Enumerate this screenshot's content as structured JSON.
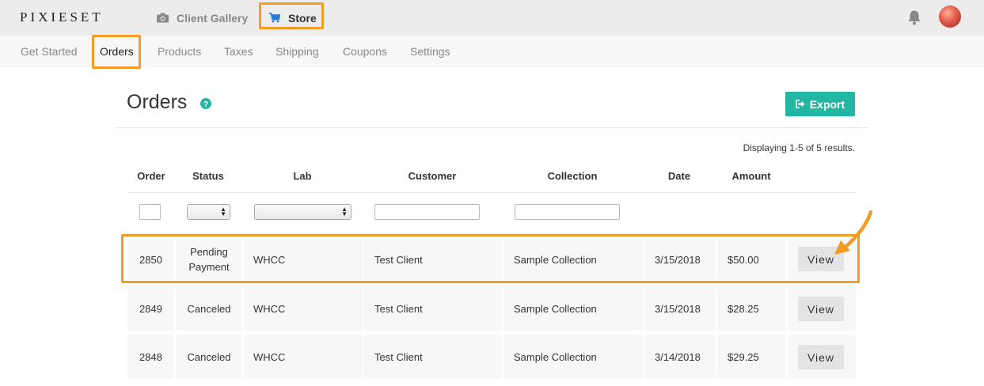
{
  "brand": "PIXIESET",
  "topnav": {
    "gallery_label": "Client Gallery",
    "store_label": "Store"
  },
  "subnav": [
    {
      "label": "Get Started"
    },
    {
      "label": "Orders"
    },
    {
      "label": "Products"
    },
    {
      "label": "Taxes"
    },
    {
      "label": "Shipping"
    },
    {
      "label": "Coupons"
    },
    {
      "label": "Settings"
    }
  ],
  "page": {
    "title": "Orders",
    "export_label": "Export",
    "results_text": "Displaying 1-5 of 5 results."
  },
  "table": {
    "columns": [
      "Order",
      "Status",
      "Lab",
      "Customer",
      "Collection",
      "Date",
      "Amount"
    ],
    "rows": [
      {
        "order": "2850",
        "status": "Pending Payment",
        "lab": "WHCC",
        "customer": "Test Client",
        "collection": "Sample Collection",
        "date": "3/15/2018",
        "amount": "$50.00",
        "action": "View"
      },
      {
        "order": "2849",
        "status": "Canceled",
        "lab": "WHCC",
        "customer": "Test Client",
        "collection": "Sample Collection",
        "date": "3/15/2018",
        "amount": "$28.25",
        "action": "View"
      },
      {
        "order": "2848",
        "status": "Canceled",
        "lab": "WHCC",
        "customer": "Test Client",
        "collection": "Sample Collection",
        "date": "3/14/2018",
        "amount": "$29.25",
        "action": "View"
      }
    ]
  },
  "colors": {
    "accent": "#21b7a2",
    "highlight": "#f39c24"
  },
  "icons": {
    "camera": "camera-icon",
    "cart": "cart-icon",
    "bell": "bell-icon",
    "help": "help-icon",
    "export": "export-icon",
    "arrow": "annotation-arrow-icon"
  }
}
